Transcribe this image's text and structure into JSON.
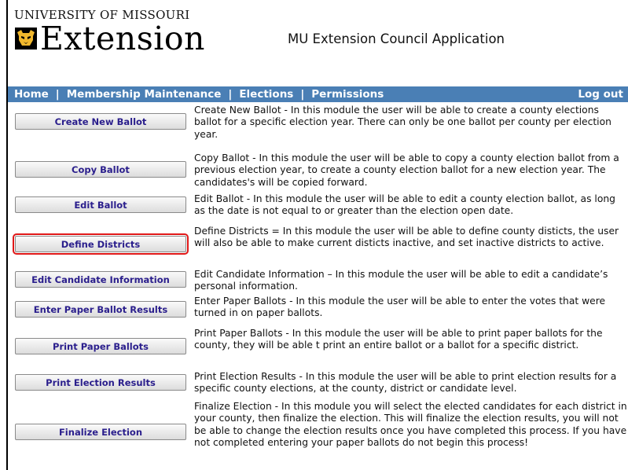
{
  "header": {
    "university": "UNIVERSITY OF MISSOURI",
    "extension": "Extension",
    "app_title": "MU Extension Council Application"
  },
  "nav": {
    "home": "Home",
    "membership": "Membership Maintenance",
    "elections": "Elections",
    "permissions": "Permissions",
    "logout": "Log out",
    "separator": "|"
  },
  "modules": [
    {
      "button": "Create New Ballot",
      "description": "Create New Ballot - In this module the user will be able to create a county elections ballot for a specific election year. There can only be one ballot per county per election year."
    },
    {
      "button": "Copy Ballot",
      "description": "Copy Ballot - In this module the user will be able to copy a county election ballot from a previous election year, to create a county election ballot for a new election year. The candidates's will be copied forward."
    },
    {
      "button": "Edit Ballot",
      "description": "Edit Ballot - In this module the user will be able to edit a county election ballot, as long as the date is not equal to or greater than the election open date."
    },
    {
      "button": "Define Districts",
      "description": "Define Districts = In this module the user will be able to define county disticts, the user will also be able to make current disticts inactive, and set inactive districts to active."
    },
    {
      "button": "Edit Candidate Information",
      "description": "Edit Candidate Information – In this module the user will be able to edit a candidate’s personal information."
    },
    {
      "button": "Enter Paper Ballot Results",
      "description": "Enter Paper Ballots - In this module the user will be able to enter the votes that were turned in on paper ballots."
    },
    {
      "button": "Print Paper Ballots",
      "description": "Print Paper Ballots - In this module the user will be able to print paper ballots for the county, they will be able t print an entire ballot or a ballot for a specific district."
    },
    {
      "button": "Print Election Results",
      "description": "Print Election Results - In this module the user will be able to print election results for a specific county elections, at the county, district or candidate level."
    },
    {
      "button": "Finalize Election",
      "description": "Finalize Election - In this module you will select the elected candidates for each district in your county, then finalize the election. This will finalize the election results, you will not be able to change the election results once you have completed this process. If you have not completed entering your paper ballots do not begin this process!"
    }
  ],
  "highlighted_module": "Define Districts",
  "colors": {
    "nav_bar": "#4a7fb5",
    "button_text": "#2a1e8c",
    "highlight_box": "#e01818",
    "logo_gold": "#f1b82d"
  },
  "icons": {
    "logo": "mizzou-tiger-icon"
  }
}
